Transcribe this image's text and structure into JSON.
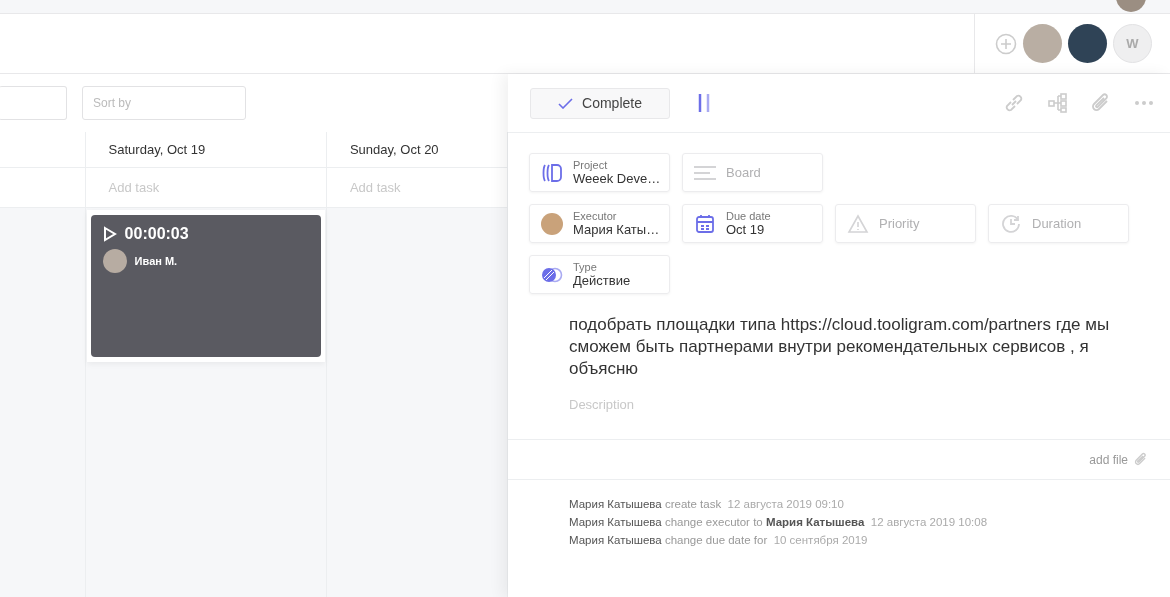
{
  "header": {
    "members": [
      {
        "kind": "photo"
      },
      {
        "kind": "photo"
      },
      {
        "kind": "letter",
        "label": "W"
      }
    ]
  },
  "filters": {
    "sort_placeholder": "Sort by"
  },
  "columns": [
    {
      "title": "Saturday, Oct 19",
      "add_label": "Add task",
      "cards": [
        {
          "timer": {
            "time": "00:00:03",
            "user": "Иван М."
          }
        }
      ]
    },
    {
      "title": "Sunday, Oct 20",
      "add_label": "Add task"
    }
  ],
  "panel": {
    "complete_label": "Complete",
    "field_rows": [
      [
        {
          "kind": "project",
          "label": "Project",
          "value": "Weeek Deve…"
        },
        {
          "kind": "board",
          "placeholder": "Board"
        }
      ],
      [
        {
          "kind": "executor",
          "label": "Executor",
          "value": "Мария Каты…"
        },
        {
          "kind": "due",
          "label": "Due date",
          "value": "Oct 19"
        },
        {
          "kind": "priority",
          "placeholder": "Priority"
        },
        {
          "kind": "duration",
          "placeholder": "Duration"
        }
      ],
      [
        {
          "kind": "type",
          "label": "Type",
          "value": "Действие"
        }
      ]
    ],
    "description": "подобрать площадки типа https://cloud.tooligram.com/partners где мы сможем быть партнерами внутри рекомендательных сервисов , я объясню",
    "description_placeholder": "Description",
    "add_file": "add file",
    "activity": [
      {
        "user": "Мария Катышева",
        "action": "create task",
        "time": "12 августа 2019 09:10"
      },
      {
        "user": "Мария Катышева",
        "action": "change executor to",
        "target": "Мария Катышева",
        "time": "12 августа 2019 10:08"
      },
      {
        "user": "Мария Катышева",
        "action": "change due date for",
        "time": "10 сентября 2019"
      }
    ]
  }
}
